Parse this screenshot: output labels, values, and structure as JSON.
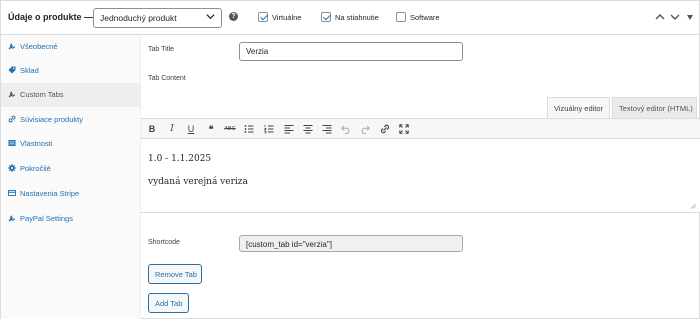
{
  "header": {
    "title": "Údaje o produkte —",
    "product_type": "Jednoduchý produkt",
    "help": "?",
    "options": [
      {
        "label": "Virtuálne",
        "checked": true
      },
      {
        "label": "Na stiahnutie",
        "checked": true
      },
      {
        "label": "Software",
        "checked": false
      }
    ]
  },
  "sidebar": {
    "items": [
      {
        "label": "Všeobecné",
        "icon": "wrench-icon"
      },
      {
        "label": "Sklad",
        "icon": "tag-icon"
      },
      {
        "label": "Custom Tabs",
        "icon": "wrench-icon",
        "active": true
      },
      {
        "label": "Súvisiace produkty",
        "icon": "link-icon"
      },
      {
        "label": "Vlastnosti",
        "icon": "list-icon"
      },
      {
        "label": "Pokročilé",
        "icon": "gear-icon"
      },
      {
        "label": "Nastavenia Stripe",
        "icon": "card-icon"
      },
      {
        "label": "PayPal Settings",
        "icon": "wrench-icon"
      }
    ]
  },
  "main": {
    "tab_title_label": "Tab Title",
    "tab_title_value": "Verzia",
    "tab_content_label": "Tab Content",
    "editor_tabs": {
      "visual": "Vizuálny editor",
      "html": "Textový editor (HTML)"
    },
    "toolbar": {
      "bold": "B",
      "italic": "I",
      "underline": "U",
      "quote": "❝",
      "strike": "ABC",
      "bullets": "bullet-list-icon",
      "numbers": "number-list-icon",
      "align_left": "align-left-icon",
      "align_center": "align-center-icon",
      "align_right": "align-right-icon",
      "undo": "undo-icon",
      "redo": "redo-icon",
      "link": "link-icon",
      "fullscreen": "fullscreen-icon"
    },
    "editor_lines": [
      "1.0 - 1.1.2025",
      "vydaná verejná veriza"
    ],
    "shortcode_label": "Shortcode",
    "shortcode_value": "[custom_tab id=\"verzia\"]",
    "remove_button": "Remove Tab",
    "add_button": "Add Tab"
  },
  "colors": {
    "accent": "#2271b1",
    "border": "#dcdcde",
    "sidebar_bg": "#fafafa"
  }
}
